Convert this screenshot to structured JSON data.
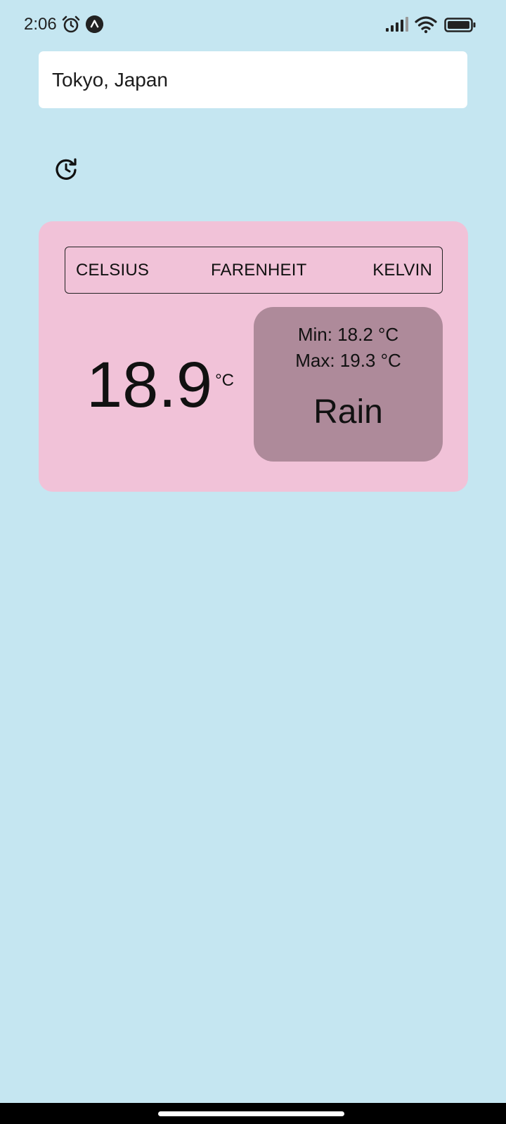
{
  "status_bar": {
    "time": "2:06",
    "icons": [
      "alarm-icon",
      "app-notification-icon",
      "signal-icon",
      "wifi-icon",
      "battery-icon"
    ]
  },
  "search": {
    "value": "Tokyo, Japan"
  },
  "history_button": {
    "icon": "history-icon"
  },
  "weather": {
    "units": [
      "CELSIUS",
      "FARENHEIT",
      "KELVIN"
    ],
    "selected_unit": "CELSIUS",
    "temperature": "18.9",
    "temperature_unit": "°C",
    "min": "Min: 18.2 °C",
    "max": "Max: 19.3 °C",
    "condition": "Rain"
  },
  "colors": {
    "background": "#c5e6f1",
    "card": "#f1c2d8",
    "details": "#ae8a9a",
    "search_bg": "#ffffff"
  }
}
